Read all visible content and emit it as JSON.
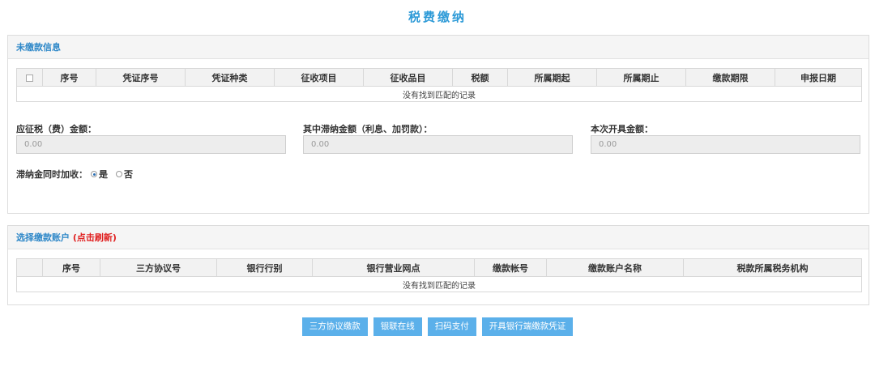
{
  "page": {
    "title": "税费缴纳"
  },
  "unpaid": {
    "header": "未缴款信息",
    "columns": [
      "序号",
      "凭证序号",
      "凭证种类",
      "征收项目",
      "征收品目",
      "税额",
      "所属期起",
      "所属期止",
      "缴款期限",
      "申报日期"
    ],
    "empty_text": "没有找到匹配的记录"
  },
  "amounts": {
    "due": {
      "label": "应征税（费）金额：",
      "value": "0.00"
    },
    "late": {
      "label": "其中滞纳金额（利息、加罚款）：",
      "value": "0.00"
    },
    "issue": {
      "label": "本次开具金额：",
      "value": "0.00"
    }
  },
  "late_fee": {
    "label": "滞纳金同时加收：",
    "options": [
      {
        "label": "是",
        "checked": true
      },
      {
        "label": "否",
        "checked": false
      }
    ]
  },
  "account": {
    "header": "选择缴款账户",
    "refresh_label": "(点击刷新)",
    "columns": [
      "序号",
      "三方协议号",
      "银行行别",
      "银行营业网点",
      "缴款帐号",
      "缴款账户名称",
      "税款所属税务机构"
    ],
    "empty_text": "没有找到匹配的记录"
  },
  "actions": {
    "tripartite": "三方协议缴款",
    "unionpay": "银联在线",
    "scan": "扫码支付",
    "bank_voucher": "开具银行端缴款凭证"
  }
}
